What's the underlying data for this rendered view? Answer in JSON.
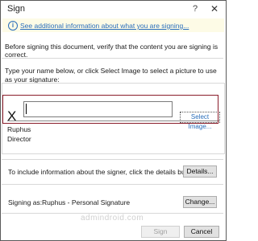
{
  "window": {
    "title": "Sign",
    "help_glyph": "?",
    "close_glyph": "✕"
  },
  "info_bar": {
    "icon": "info-icon",
    "link_text": "See additional information about what you are signing..."
  },
  "verify_text": "Before signing this document, verify that the content you are signing is correct.",
  "prompt_text": "Type your name below, or click Select Image to select a picture to use as your signature:",
  "signature": {
    "x_mark": "X",
    "input_value": "",
    "select_image_label": "Select Image...",
    "signer_name": "Ruphus",
    "signer_title": "Director"
  },
  "details": {
    "text": "To include information about the signer, click the details button.",
    "button_label": "Details..."
  },
  "signing_as": {
    "label": "Signing as:",
    "value": "Ruphus - Personal Signature",
    "change_label": "Change..."
  },
  "watermark": "admindroid.com",
  "footer": {
    "sign_label": "Sign",
    "cancel_label": "Cancel"
  },
  "colors": {
    "link": "#2a6ebb",
    "info_bg": "#fdfbe6",
    "highlight": "#8a1c2a"
  }
}
